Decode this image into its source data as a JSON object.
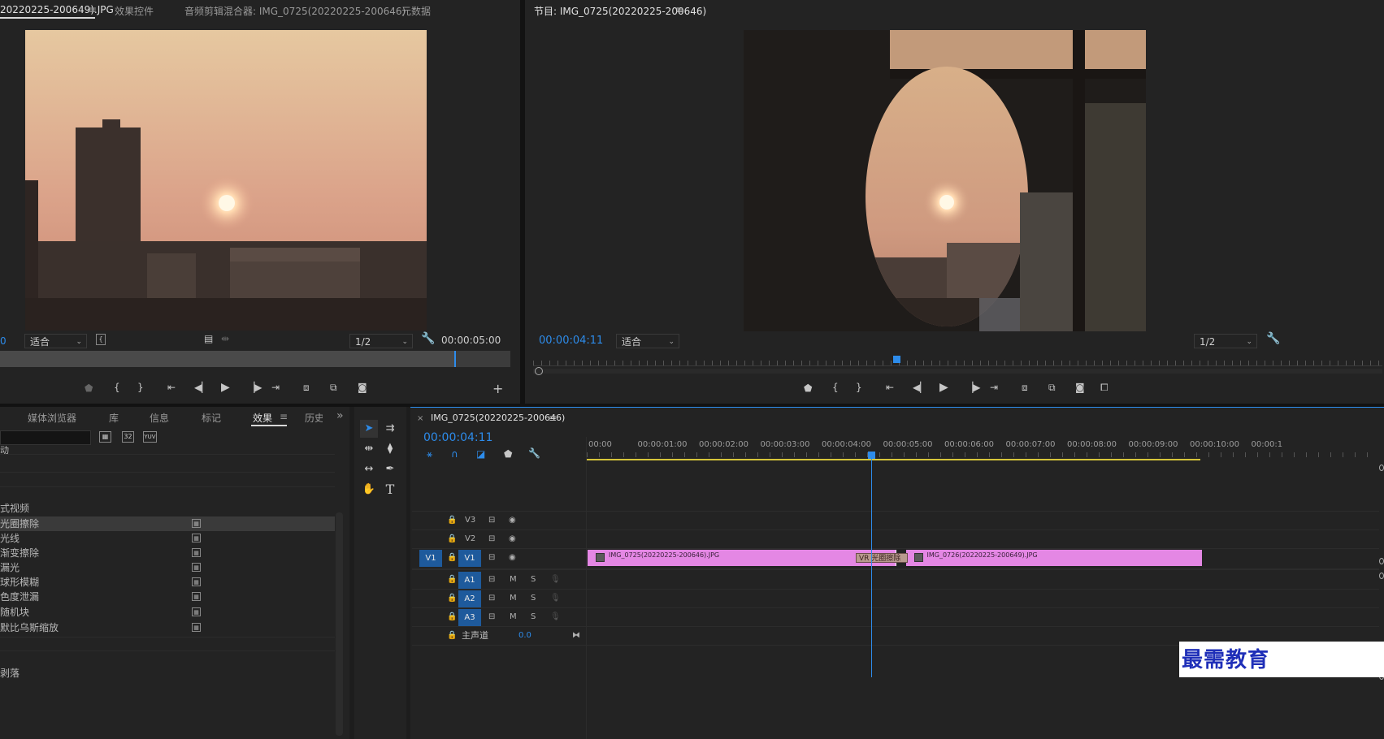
{
  "source_panel": {
    "tabs": [
      {
        "label": "20220225-200649).JPG",
        "active": true
      },
      {
        "label": "效果控件",
        "active": false
      },
      {
        "label": "音频剪辑混合器: IMG_0725(20220225-200646)",
        "active": false
      },
      {
        "label": "元数据",
        "active": false
      }
    ],
    "left_timecode": "0",
    "fit": "适合",
    "resolution": "1/2",
    "duration": "00:00:05:00"
  },
  "program_panel": {
    "title": "节目: IMG_0725(20220225-200646)",
    "timecode": "00:00:04:11",
    "fit": "适合",
    "resolution": "1/2"
  },
  "effects_panel": {
    "tabs": [
      {
        "label": "媒体浏览器",
        "active": false
      },
      {
        "label": "库",
        "active": false
      },
      {
        "label": "信息",
        "active": false
      },
      {
        "label": "标记",
        "active": false
      },
      {
        "label": "效果",
        "active": true
      },
      {
        "label": "历史",
        "active": false
      }
    ],
    "header_fragment": "动",
    "category": "式视频",
    "items": [
      {
        "label": "光圈擦除",
        "selected": true
      },
      {
        "label": "光线",
        "selected": false
      },
      {
        "label": "渐变擦除",
        "selected": false
      },
      {
        "label": "漏光",
        "selected": false
      },
      {
        "label": "球形模糊",
        "selected": false
      },
      {
        "label": "色度泄漏",
        "selected": false
      },
      {
        "label": "随机块",
        "selected": false
      },
      {
        "label": "默比乌斯缩放",
        "selected": false
      }
    ],
    "bottom_fragment": "剥落",
    "filter_badges": [
      "32",
      "YUV"
    ]
  },
  "timeline": {
    "sequence_name": "IMG_0725(20220225-200646)",
    "timecode": "00:00:04:11",
    "ruler": [
      "00:00",
      "00:00:01:00",
      "00:00:02:00",
      "00:00:03:00",
      "00:00:04:00",
      "00:00:05:00",
      "00:00:06:00",
      "00:00:07:00",
      "00:00:08:00",
      "00:00:09:00",
      "00:00:10:00",
      "00:00:1"
    ],
    "playhead_seconds": 4.44,
    "video_tracks": [
      "V3",
      "V2",
      "V1"
    ],
    "source_patch": "V1",
    "audio_tracks": [
      "A1",
      "A2",
      "A3"
    ],
    "track_m": "M",
    "track_s": "S",
    "master": {
      "label": "主声道",
      "value": "0.0"
    },
    "clips": [
      {
        "name": "IMG_0725(20220225-200646).JPG",
        "start": 0.0,
        "end": 5.0
      },
      {
        "name": "IMG_0726(20220225-200649).JPG",
        "start": 5.0,
        "end": 10.0
      }
    ],
    "transition": {
      "label": "VR 光圈擦除",
      "start": 4.0,
      "end": 5.0
    }
  },
  "watermark": "最需教育",
  "colors": {
    "accent": "#2d8ceb",
    "clip": "#e487e4",
    "track_toggle": "#1e5a9c",
    "work_area": "#d5c43a"
  }
}
